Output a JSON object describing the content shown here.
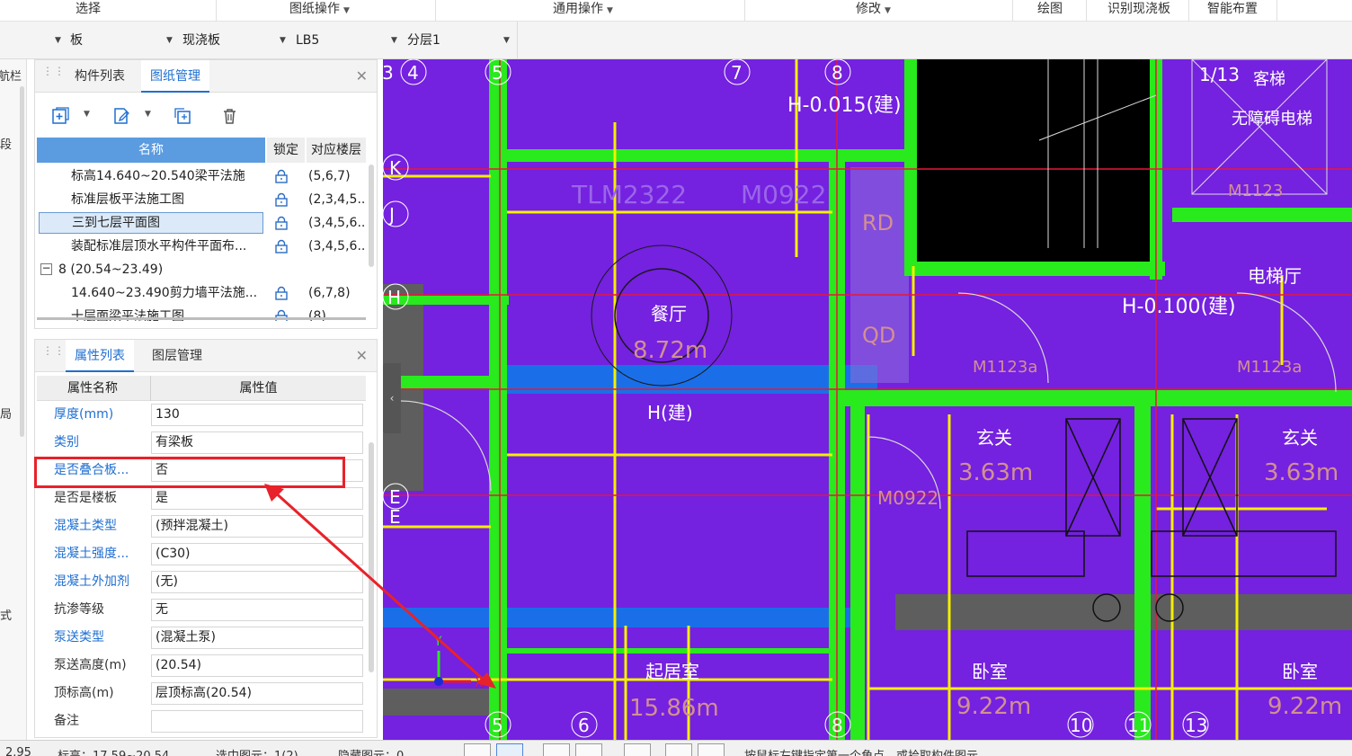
{
  "ribbon": {
    "groups": [
      "选择",
      "图纸操作",
      "通用操作",
      "修改",
      "绘图",
      "识别现浇板",
      "智能布置"
    ]
  },
  "selectors": {
    "floor_value": "",
    "category": "板",
    "type": "现浇板",
    "component": "LB5",
    "layer": "分层1"
  },
  "nav_strip": {
    "title": "航栏",
    "chars": [
      "段",
      "局",
      "式"
    ]
  },
  "drawing_panel": {
    "tabs": [
      "构件列表",
      "图纸管理"
    ],
    "active_tab": "图纸管理",
    "columns": {
      "name": "名称",
      "lock": "锁定",
      "floor": "对应楼层"
    },
    "rows": [
      {
        "name": "标高14.640~20.540梁平法施",
        "floor": "(5,6,7)"
      },
      {
        "name": "标准层板平法施工图",
        "floor": "(2,3,4,5..."
      },
      {
        "name": "三到七层平面图",
        "floor": "(3,4,5,6..."
      },
      {
        "name": "装配标准层顶水平构件平面布...",
        "floor": "(3,4,5,6..."
      },
      {
        "group": "8 (20.54~23.49)"
      },
      {
        "name": "14.640~23.490剪力墙平法施...",
        "floor": "(6,7,8)"
      },
      {
        "name": "十层面梁平法施工图",
        "floor": "(8)"
      }
    ]
  },
  "property_panel": {
    "tabs": [
      "属性列表",
      "图层管理"
    ],
    "active_tab": "属性列表",
    "columns": {
      "name": "属性名称",
      "value": "属性值"
    },
    "rows": [
      {
        "name": "厚度(mm)",
        "value": "130",
        "blue": true
      },
      {
        "name": "类别",
        "value": "有梁板",
        "blue": true
      },
      {
        "name": "是否叠合板...",
        "value": "否",
        "blue": true
      },
      {
        "name": "是否是楼板",
        "value": "是",
        "blue": false
      },
      {
        "name": "混凝土类型",
        "value": "(预拌混凝土)",
        "blue": true
      },
      {
        "name": "混凝土强度...",
        "value": "(C30)",
        "blue": true
      },
      {
        "name": "混凝土外加剂",
        "value": "(无)",
        "blue": true
      },
      {
        "name": "抗渗等级",
        "value": "无",
        "blue": false
      },
      {
        "name": "泵送类型",
        "value": "(混凝土泵)",
        "blue": true
      },
      {
        "name": "泵送高度(m)",
        "value": "(20.54)",
        "blue": false
      },
      {
        "name": "顶标高(m)",
        "value": "层顶标高(20.54)",
        "blue": false
      },
      {
        "name": "备注",
        "value": "",
        "blue": false
      }
    ]
  },
  "canvas": {
    "axis_top": [
      "3",
      "4",
      "5",
      "7",
      "8",
      "1/13"
    ],
    "axis_left": [
      "K",
      "J",
      "H",
      "E",
      "E"
    ],
    "axis_bottom": [
      "5",
      "6",
      "8",
      "10",
      "11",
      "13"
    ],
    "room_labels": [
      "餐厅",
      "8.72m",
      "玄关",
      "3.63m",
      "玄关",
      "3.63m",
      "起居室",
      "15.86m",
      "卧室",
      "9.22m",
      "卧室",
      "9.22m",
      "电梯厅",
      "客梯",
      "无障碍电梯"
    ],
    "tag_labels": [
      "H-0.015(建)",
      "H-0.100(建)",
      "H(建)",
      "M0922",
      "M1123",
      "M1123a",
      "M1123a",
      "RD",
      "QD",
      "TLM2322",
      "M0922"
    ],
    "axis_x_label": "X",
    "axis_y_label": "Y",
    "colors": {
      "background": "#7421e0",
      "wall": "#29ea1d",
      "line_yellow": "#f4f000",
      "line_red": "#e8163a",
      "beam_blue": "#1a6fe8"
    }
  },
  "status_bar": {
    "coord": "2.95",
    "elevation": "标高：17.59~20.54",
    "selected": "选中图元：1(2)",
    "hidden": "隐藏图元：0",
    "hint": "按鼠标左键指定第一个角点，或拾取构件图元"
  }
}
